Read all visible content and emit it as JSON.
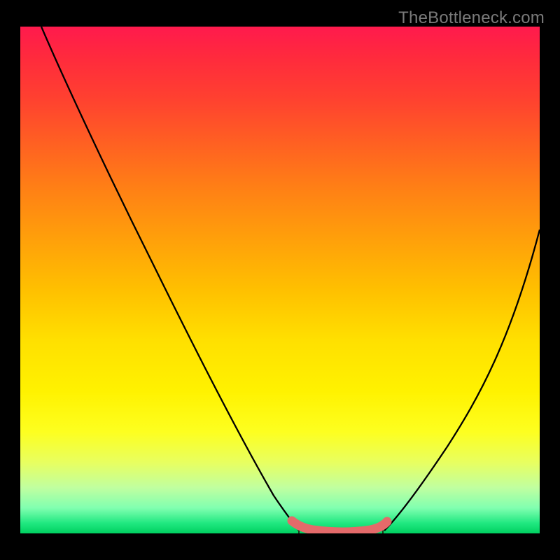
{
  "watermark": "TheBottleneck.com",
  "chart_data": {
    "type": "line",
    "title": "",
    "xlabel": "",
    "ylabel": "",
    "xlim": [
      0,
      1
    ],
    "ylim": [
      0,
      1
    ],
    "grid": false,
    "legend": false,
    "series": [
      {
        "name": "left-curve",
        "stroke": "#000000",
        "x": [
          0.041,
          0.1,
          0.18,
          0.26,
          0.34,
          0.42,
          0.49,
          0.53
        ],
        "values": [
          1.0,
          0.84,
          0.66,
          0.48,
          0.31,
          0.15,
          0.035,
          0.005
        ]
      },
      {
        "name": "right-curve",
        "stroke": "#000000",
        "x": [
          0.7,
          0.76,
          0.82,
          0.88,
          0.94,
          1.0
        ],
        "values": [
          0.005,
          0.07,
          0.17,
          0.3,
          0.44,
          0.6
        ]
      },
      {
        "name": "bottom-flat-segment",
        "stroke": "#e46a6a",
        "stroke_width_px": 12,
        "x": [
          0.52,
          0.545,
          0.57,
          0.6,
          0.63,
          0.66,
          0.69,
          0.705
        ],
        "values": [
          0.022,
          0.011,
          0.006,
          0.003,
          0.003,
          0.006,
          0.012,
          0.021
        ]
      }
    ],
    "annotations": [
      {
        "type": "ticks",
        "description": "short dark vertical tick marks under bottom flat segment",
        "x": [
          0.53,
          0.55,
          0.57,
          0.59,
          0.61,
          0.63,
          0.65,
          0.67,
          0.69
        ],
        "values": [
          0.002,
          0.002,
          0.002,
          0.002,
          0.002,
          0.002,
          0.002,
          0.002,
          0.002
        ]
      }
    ]
  }
}
